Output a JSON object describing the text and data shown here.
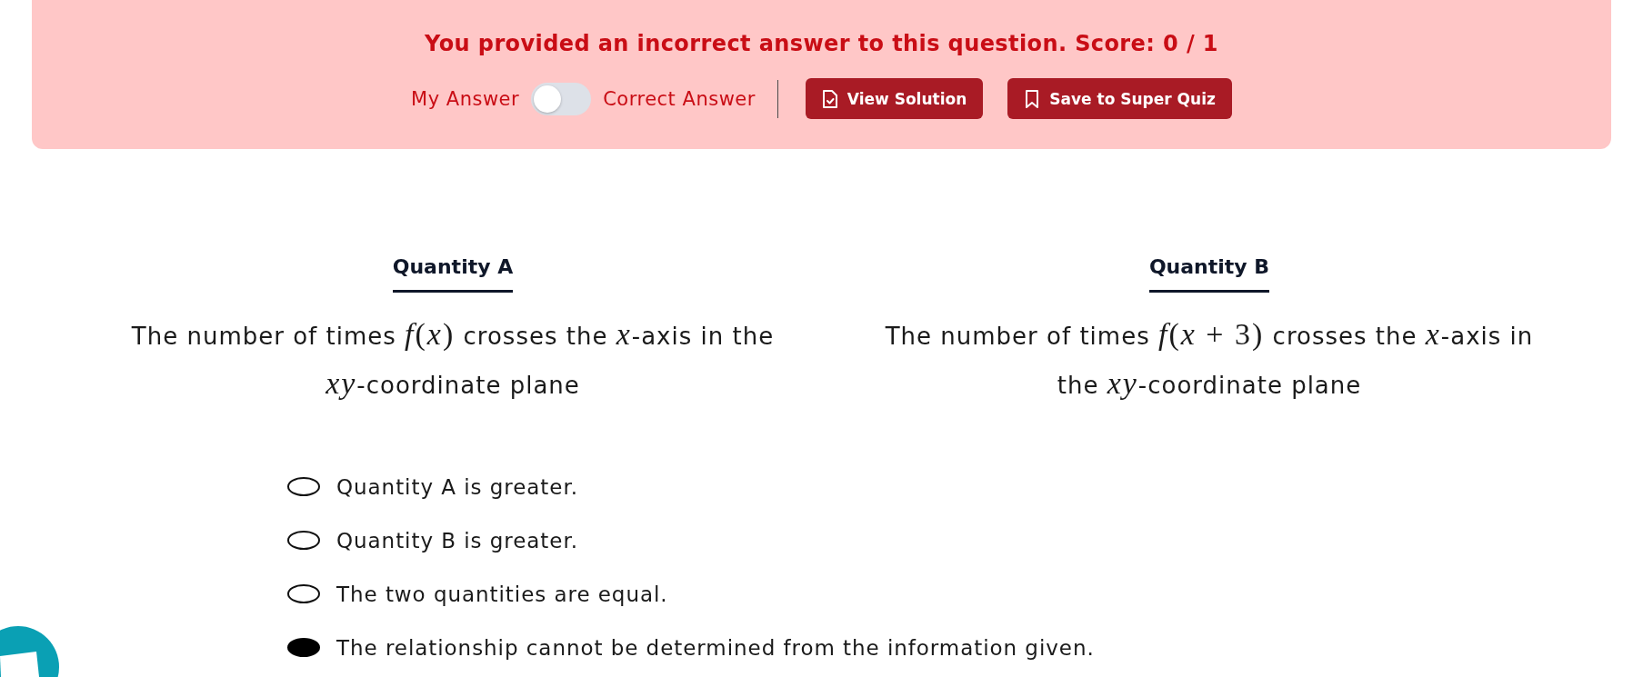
{
  "feedback": {
    "message": "You provided an incorrect answer to this question. Score: 0 / 1",
    "toggle": {
      "left_label": "My Answer",
      "right_label": "Correct Answer",
      "on": false
    },
    "buttons": [
      {
        "kind": "solution",
        "label": "View Solution"
      },
      {
        "kind": "save",
        "label": "Save to Super Quiz"
      }
    ]
  },
  "quantities": [
    {
      "heading": "Quantity A",
      "parts": [
        {
          "kind": "text",
          "text": "The number of times "
        },
        {
          "kind": "math",
          "text": "*f*(*x*)"
        },
        {
          "kind": "text",
          "text": " crosses the "
        },
        {
          "kind": "math",
          "text": "*x*"
        },
        {
          "kind": "text",
          "text": "-axis in the "
        },
        {
          "kind": "math",
          "text": "*xy*"
        },
        {
          "kind": "text",
          "text": "-coordinate plane"
        }
      ]
    },
    {
      "heading": "Quantity B",
      "parts": [
        {
          "kind": "text",
          "text": "The number of times "
        },
        {
          "kind": "math",
          "text": "*f*(*x* + 3)"
        },
        {
          "kind": "text",
          "text": " crosses the "
        },
        {
          "kind": "math",
          "text": "*x*"
        },
        {
          "kind": "text",
          "text": "-axis in the "
        },
        {
          "kind": "math",
          "text": "*xy*"
        },
        {
          "kind": "text",
          "text": "-coordinate plane"
        }
      ]
    }
  ],
  "options": [
    {
      "label": "Quantity A is greater.",
      "selected": false
    },
    {
      "label": "Quantity B is greater.",
      "selected": false
    },
    {
      "label": "The two quantities are equal.",
      "selected": false
    },
    {
      "label": "The relationship cannot be determined from the information given.",
      "selected": true
    }
  ]
}
